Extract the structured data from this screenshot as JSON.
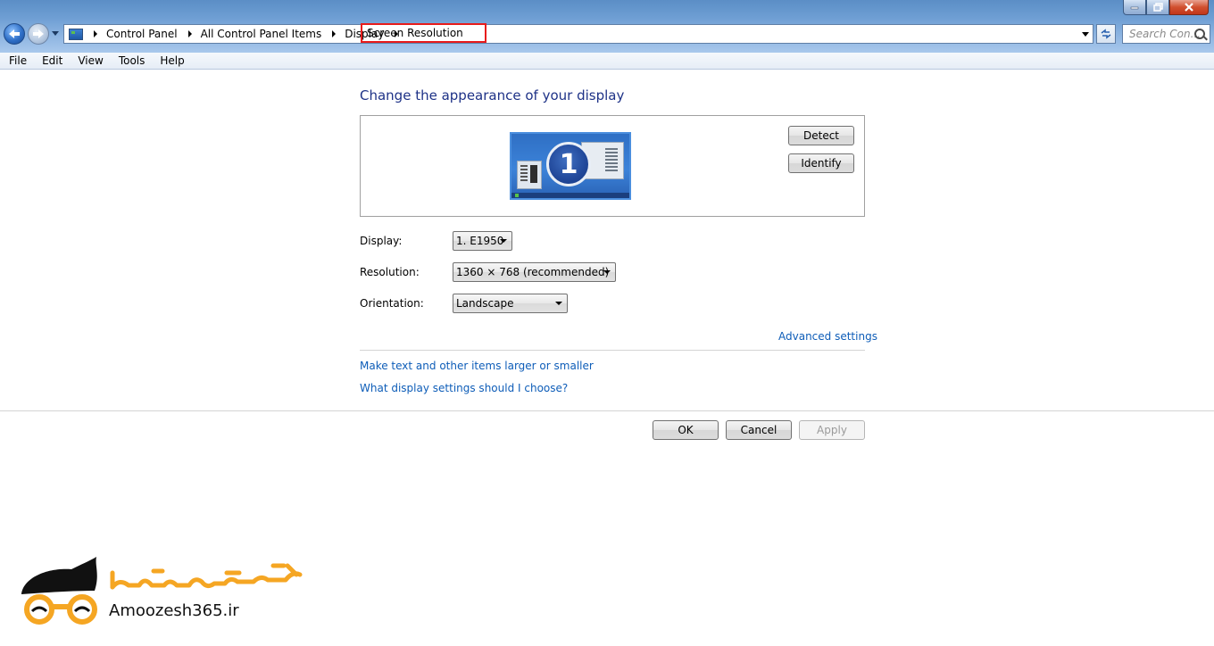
{
  "breadcrumb": {
    "items": [
      "Control Panel",
      "All Control Panel Items",
      "Display"
    ],
    "current": "Screen Resolution"
  },
  "search": {
    "placeholder": "Search Con..."
  },
  "menu": [
    "File",
    "Edit",
    "View",
    "Tools",
    "Help"
  ],
  "main": {
    "heading": "Change the appearance of your display",
    "monitor_number": "1",
    "detect_label": "Detect",
    "identify_label": "Identify",
    "display_label": "Display:",
    "display_value": "1. E1950",
    "resolution_label": "Resolution:",
    "resolution_value": "1360 × 768 (recommended)",
    "orientation_label": "Orientation:",
    "orientation_value": "Landscape",
    "advanced_link": "Advanced settings",
    "text_size_link": "Make text and other items larger or smaller",
    "help_link": "What display settings should I choose?"
  },
  "buttons": {
    "ok": "OK",
    "cancel": "Cancel",
    "apply": "Apply"
  },
  "watermark": {
    "site": "Amoozesh365.ir"
  },
  "colors": {
    "heading": "#1e3287",
    "link": "#0e5db8",
    "highlight": "#e81b1b",
    "logo_accent": "#f5a623"
  }
}
